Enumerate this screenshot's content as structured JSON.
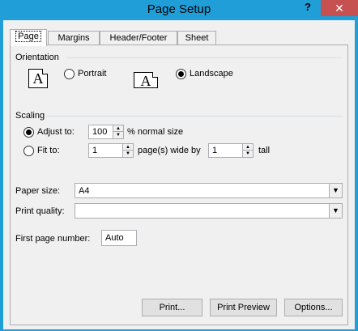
{
  "window": {
    "title": "Page Setup",
    "help_label": "?",
    "close_label": "✕"
  },
  "tabs": [
    "Page",
    "Margins",
    "Header/Footer",
    "Sheet"
  ],
  "orientation": {
    "label": "Orientation",
    "portrait_icon_letter": "A",
    "portrait_label": "Portrait",
    "landscape_icon_letter": "A",
    "landscape_label": "Landscape",
    "selected": "landscape"
  },
  "scaling": {
    "label": "Scaling",
    "adjust_label": "Adjust to:",
    "adjust_value": "100",
    "adjust_suffix": "% normal size",
    "fit_label": "Fit to:",
    "fit_wide_value": "1",
    "fit_wide_suffix": "page(s) wide by",
    "fit_tall_value": "1",
    "fit_tall_suffix": "tall",
    "selected": "adjust"
  },
  "paper_size": {
    "label": "Paper size:",
    "value": "A4"
  },
  "print_quality": {
    "label": "Print quality:",
    "value": ""
  },
  "first_page_number": {
    "label": "First page number:",
    "value": "Auto"
  },
  "buttons": {
    "print": "Print...",
    "print_preview": "Print Preview",
    "options": "Options..."
  },
  "icons": {
    "spin_up": "▲",
    "spin_down": "▼",
    "dropdown": "▼"
  }
}
